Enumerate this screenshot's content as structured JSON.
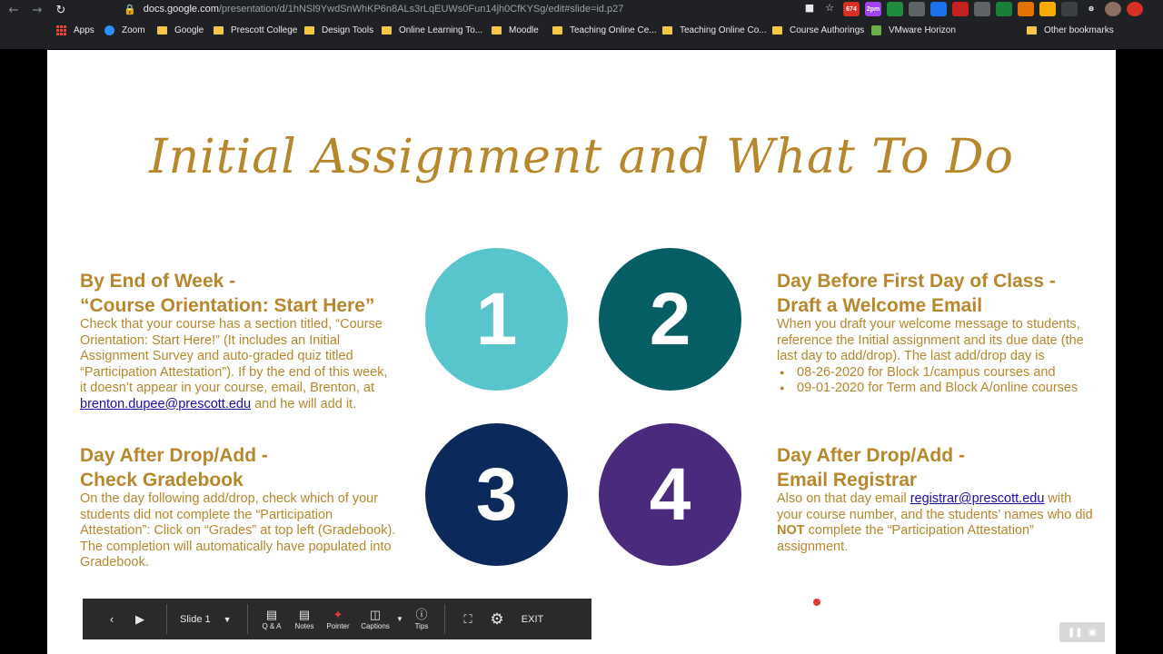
{
  "browser": {
    "url_host": "docs.google.com",
    "url_path": "/presentation/d/1hNSl9YwdSnWhKP6n8ALs3rLqEUWs0Fun14jh0CfKYSg/edit#slide=id.p27",
    "ext_badges": [
      "674",
      "2pm"
    ],
    "bookmarks": [
      "Apps",
      "Zoom",
      "Google",
      "Prescott College",
      "Design Tools",
      "Online Learning To...",
      "Moodle",
      "Teaching Online Ce...",
      "Teaching Online Co...",
      "Course Authorings",
      "VMware Horizon",
      "Other bookmarks"
    ]
  },
  "slide": {
    "title": "Initial Assignment and What To Do",
    "circles": [
      "1",
      "2",
      "3",
      "4"
    ],
    "colors": {
      "c1": "#58c4cc",
      "c2": "#065e65",
      "c3": "#0b2a5b",
      "c4": "#4a2a7c",
      "accent": "#b8862b"
    },
    "block1": {
      "heading1": "By End of Week -",
      "heading2": "“Course Orientation: Start Here”",
      "text_before": "Check that your course has a section titled, “Course Orientation: Start Here!” (It includes an Initial Assignment Survey and auto-graded quiz titled “Participation Attestation”). If by the end of this week,  it doesn’t appear in your course, email, Brenton, at ",
      "link": "brenton.dupee@prescott.edu",
      "text_after": " and he will add it."
    },
    "block2": {
      "heading1": "Day Before First Day of Class -",
      "heading2": "Draft a Welcome Email",
      "text": "When you draft your welcome message to students, reference the Initial  assignment and its due date (the last day to add/drop).  The last add/drop day is",
      "bullets": [
        "08-26-2020 for Block 1/campus courses and",
        "09-01-2020 for Term and Block A/online courses"
      ]
    },
    "block3": {
      "heading1": "Day After Drop/Add -",
      "heading2": "Check Gradebook",
      "text": "On the day following add/drop, check which of your students did not complete the “Participation Attestation”: Click on “Grades” at top left (Gradebook). The completion will automatically have populated into Gradebook."
    },
    "block4": {
      "heading1": "Day After Drop/Add -",
      "heading2": "Email Registrar",
      "text_before": "Also on that day email ",
      "link": "registrar@prescott.edu",
      "text_mid": " with your course number, and the students’ names who did ",
      "bold": "NOT",
      "text_after": " complete the “Participation Attestation” assignment."
    }
  },
  "toolbar": {
    "slide_label": "Slide 1",
    "qa": "Q & A",
    "notes": "Notes",
    "pointer": "Pointer",
    "captions": "Captions",
    "tips": "Tips",
    "exit": "EXIT"
  }
}
